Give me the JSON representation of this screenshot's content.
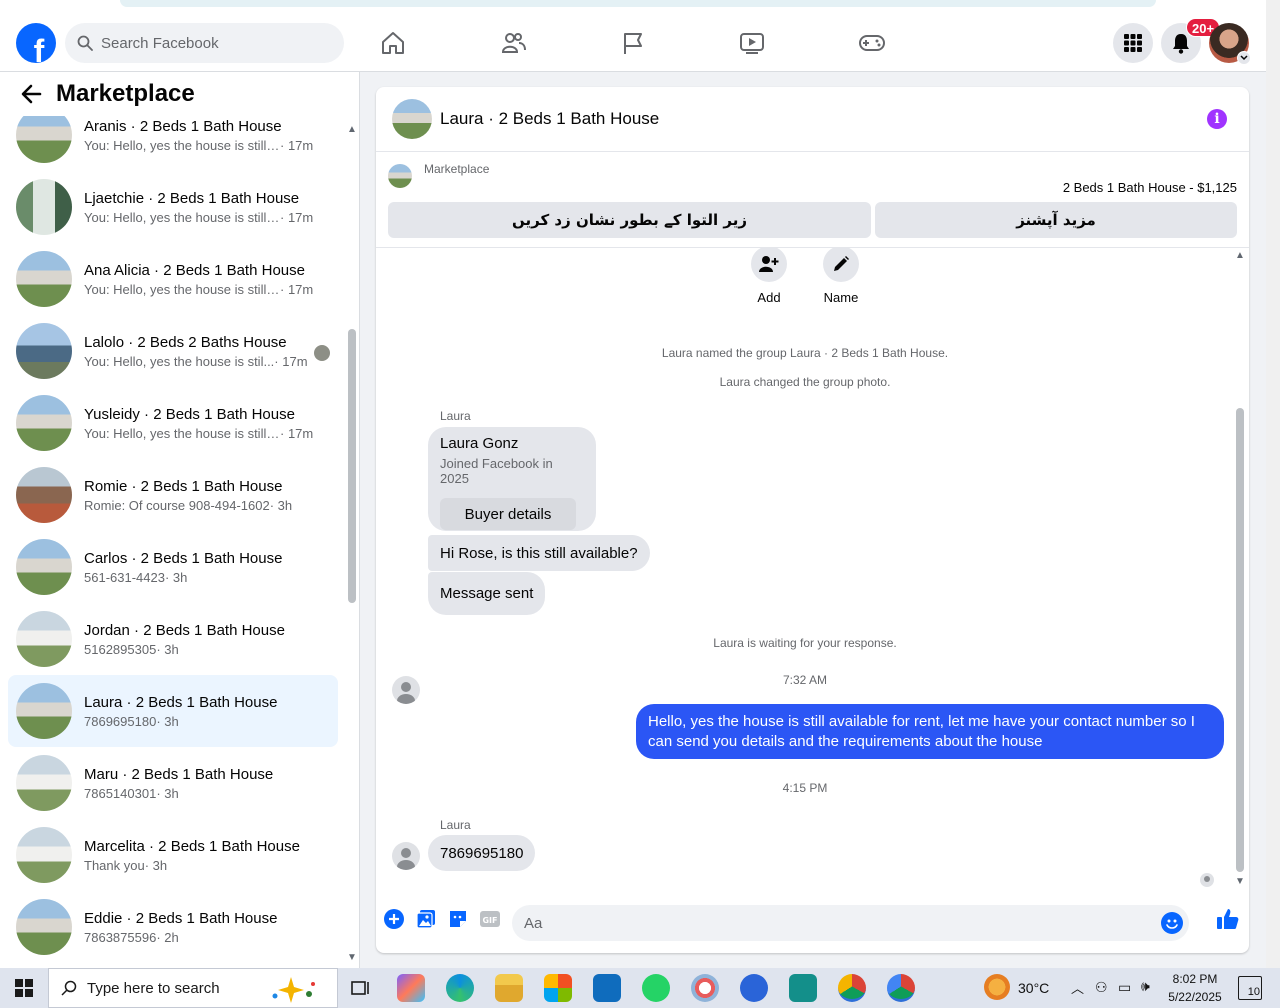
{
  "topbar": {
    "search_placeholder": "Search Facebook",
    "notification_badge": "20+"
  },
  "sidebar": {
    "title": "Marketplace",
    "conversations": [
      {
        "title": "Aranis · 2 Beds 1 Bath House",
        "preview": "You: Hello, yes the house is still a...",
        "time": "· 17m",
        "thumb": "t1"
      },
      {
        "title": "Ljaetchie · 2 Beds 1 Bath House",
        "preview": "You: Hello, yes the house is still a...",
        "time": "· 17m",
        "thumb": "t2"
      },
      {
        "title": "Ana Alicia · 2 Beds 1 Bath House",
        "preview": "You: Hello, yes the house is still a...",
        "time": "· 17m",
        "thumb": "t1"
      },
      {
        "title": "Lalolo · 2 Beds 2 Baths House",
        "preview": "You: Hello, yes the house is stil...",
        "time": "· 17m",
        "thumb": "t3",
        "seen": true
      },
      {
        "title": "Yusleidy · 2 Beds 1 Bath House",
        "preview": "You: Hello, yes the house is still a...",
        "time": "· 17m",
        "thumb": "t1"
      },
      {
        "title": "Romie · 2 Beds 1 Bath House",
        "preview": "Romie: Of course 908-494-1602",
        "time": "· 3h",
        "thumb": "t4"
      },
      {
        "title": "Carlos · 2 Beds 1 Bath House",
        "preview": "561-631-4423",
        "time": "· 3h",
        "thumb": "t1"
      },
      {
        "title": "Jordan · 2 Beds 1 Bath House",
        "preview": "5162895305",
        "time": "· 3h",
        "thumb": "t5"
      },
      {
        "title": "Laura · 2 Beds 1 Bath House",
        "preview": "7869695180",
        "time": "· 3h",
        "thumb": "t1",
        "active": true
      },
      {
        "title": "Maru · 2 Beds 1 Bath House",
        "preview": "7865140301",
        "time": "· 3h",
        "thumb": "t5"
      },
      {
        "title": "Marcelita · 2 Beds 1 Bath House",
        "preview": "Thank you",
        "time": "· 3h",
        "thumb": "t5"
      },
      {
        "title": "Eddie · 2 Beds 1 Bath House",
        "preview": "7863875596",
        "time": "· 2h",
        "thumb": "t1"
      }
    ]
  },
  "chat": {
    "title": "Laura · 2 Beds 1 Bath House",
    "marketplace_label": "Marketplace",
    "listing": "2 Beds 1 Bath House - $1,125",
    "btn_left": "زیر التوا کے بطور نشان زد کریں",
    "btn_right": "مزید آپشنز",
    "add_label": "Add",
    "name_label": "Name",
    "sys1": "Laura named the group Laura · 2 Beds 1 Bath House.",
    "sys2": "Laura changed the group photo.",
    "sender1": "Laura",
    "card_name": "Laura Gonz",
    "card_joined": "Joined Facebook in 2025",
    "card_button": "Buyer details",
    "msg1": "Hi Rose, is this still available?",
    "msg2": "Message sent",
    "waiting": "Laura is waiting for your response.",
    "time1": "7:32 AM",
    "out_msg": "Hello, yes the house is still available for rent, let me have your contact number so I can send you details and the requirements about the house",
    "time2": "4:15 PM",
    "sender2": "Laura",
    "msg3": "7869695180",
    "composer_placeholder": "Aa"
  },
  "taskbar": {
    "search_placeholder": "Type here to search",
    "temperature": "30°C",
    "time": "8:02 PM",
    "date": "5/22/2025",
    "notif_count": "10"
  },
  "colors": {
    "brand": "#0866ff",
    "outgoing_bubble": "#2b56f5",
    "active_conv": "#ebf5ff",
    "badge": "#e41e3f",
    "info": "#a033ff"
  }
}
